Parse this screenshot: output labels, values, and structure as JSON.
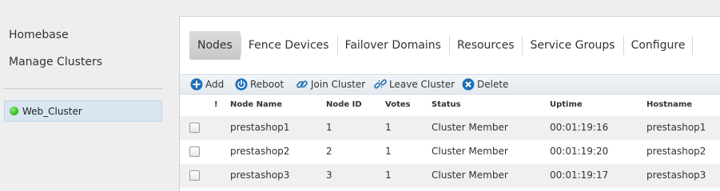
{
  "sidebar": {
    "homebase": "Homebase",
    "manage_clusters": "Manage Clusters",
    "clusters": [
      {
        "name": "Web_Cluster",
        "status_color": "#3fc12b"
      }
    ]
  },
  "tabs": [
    {
      "label": "Nodes",
      "active": true
    },
    {
      "label": "Fence Devices"
    },
    {
      "label": "Failover Domains"
    },
    {
      "label": "Resources"
    },
    {
      "label": "Service Groups"
    },
    {
      "label": "Configure"
    }
  ],
  "toolbar": {
    "add": {
      "label": "Add",
      "icon": "plus-circle-icon"
    },
    "reboot": {
      "label": "Reboot",
      "icon": "power-icon"
    },
    "join": {
      "label": "Join Cluster",
      "icon": "link-icon"
    },
    "leave": {
      "label": "Leave Cluster",
      "icon": "unlink-icon"
    },
    "delete": {
      "label": "Delete",
      "icon": "x-circle-icon"
    }
  },
  "table": {
    "headers": {
      "warn": "!",
      "name": "Node Name",
      "id": "Node ID",
      "votes": "Votes",
      "status": "Status",
      "uptime": "Uptime",
      "hostname": "Hostname"
    },
    "rows": [
      {
        "name": "prestashop1",
        "id": "1",
        "votes": "1",
        "status": "Cluster Member",
        "uptime": "00:01:19:16",
        "hostname": "prestashop1"
      },
      {
        "name": "prestashop2",
        "id": "2",
        "votes": "1",
        "status": "Cluster Member",
        "uptime": "00:01:19:20",
        "hostname": "prestashop2"
      },
      {
        "name": "prestashop3",
        "id": "3",
        "votes": "1",
        "status": "Cluster Member",
        "uptime": "00:01:19:17",
        "hostname": "prestashop3"
      }
    ]
  },
  "colors": {
    "accent": "#1e6fb8",
    "active_tab": "#cfcfcf",
    "selected_cluster": "#d9e6f1"
  }
}
